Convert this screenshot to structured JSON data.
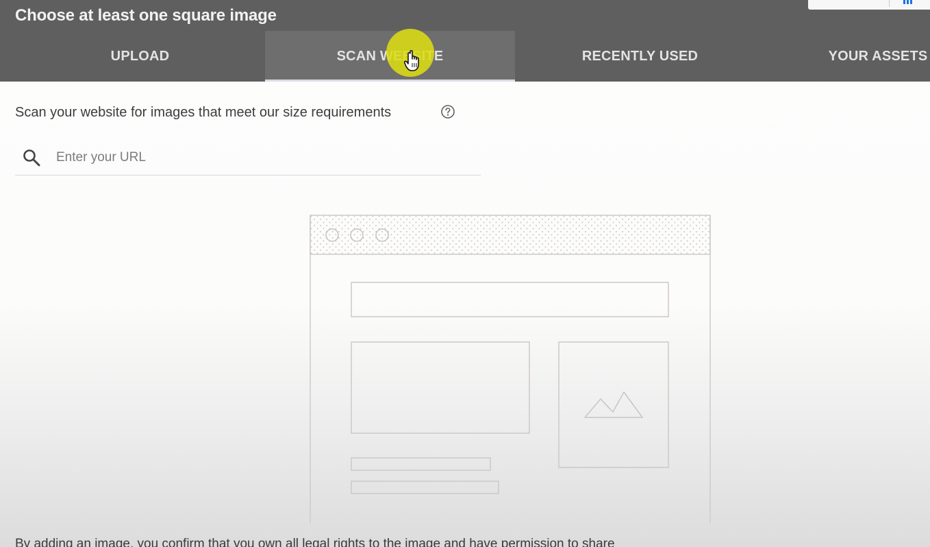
{
  "dialog": {
    "title": "Choose at least one square image"
  },
  "tabs": [
    {
      "label": "UPLOAD",
      "active": false
    },
    {
      "label": "SCAN WEBSITE",
      "active": true
    },
    {
      "label": "RECENTLY USED",
      "active": false
    },
    {
      "label": "YOUR ASSETS",
      "active": false
    }
  ],
  "scan": {
    "description": "Scan your website for images that meet our size requirements",
    "help_icon": "help-circle-icon"
  },
  "search": {
    "icon": "search-icon",
    "placeholder": "Enter your URL",
    "value": ""
  },
  "illustration": {
    "icon": "image-placeholder-icon"
  },
  "legal": {
    "text": "By adding an image, you confirm that you own all legal rights to the image and have permission to share"
  },
  "colors": {
    "header_bg": "#605f5f",
    "active_tab_bg": "#6f6e6e",
    "tab_text": "#e3e3e3",
    "cursor_highlight": "#dcdc14",
    "corner_icon": "#1a73e8"
  }
}
